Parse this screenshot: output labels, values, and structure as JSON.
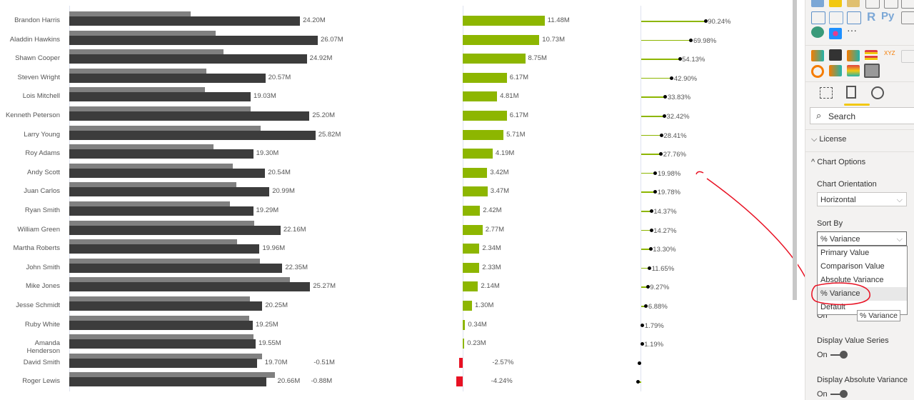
{
  "chart_data": {
    "type": "bar",
    "categories": [
      "Brandon Harris",
      "Aladdin Hawkins",
      "Shawn Cooper",
      "Steven Wright",
      "Lois Mitchell",
      "Kenneth Peterson",
      "Larry Young",
      "Roy Adams",
      "Andy Scott",
      "Juan Carlos",
      "Ryan Smith",
      "William Green",
      "Martha Roberts",
      "John Smith",
      "Mike Jones",
      "Jesse Schmidt",
      "Ruby White",
      "Amanda Henderson",
      "David Smith",
      "Roger Lewis"
    ],
    "series": [
      {
        "values": [
          24.2,
          26.07,
          24.92,
          20.57,
          19.03,
          25.2,
          25.82,
          19.3,
          20.54,
          20.99,
          19.29,
          22.16,
          19.96,
          22.35,
          25.27,
          20.25,
          19.25,
          19.55,
          19.7,
          20.66
        ],
        "labels": [
          "24.20M",
          "26.07M",
          "24.92M",
          "20.57M",
          "19.03M",
          "25.20M",
          "25.82M",
          "19.30M",
          "20.54M",
          "20.99M",
          "19.29M",
          "22.16M",
          "19.96M",
          "22.35M",
          "25.27M",
          "20.25M",
          "19.25M",
          "19.55M",
          "19.70M",
          "20.66M"
        ]
      },
      {
        "values": [
          11.48,
          10.73,
          8.75,
          6.17,
          4.81,
          6.17,
          5.71,
          4.19,
          3.42,
          3.47,
          2.42,
          2.77,
          2.34,
          2.33,
          2.14,
          1.3,
          0.34,
          0.23,
          -0.51,
          -0.88
        ],
        "labels": [
          "11.48M",
          "10.73M",
          "8.75M",
          "6.17M",
          "4.81M",
          "6.17M",
          "5.71M",
          "4.19M",
          "3.42M",
          "3.47M",
          "2.42M",
          "2.77M",
          "2.34M",
          "2.33M",
          "2.14M",
          "1.30M",
          "0.34M",
          "0.23M",
          "-0.51M",
          "-0.88M"
        ]
      },
      {
        "values": [
          90.24,
          69.98,
          54.13,
          42.9,
          33.83,
          32.42,
          28.41,
          27.76,
          19.98,
          19.78,
          14.37,
          14.27,
          13.3,
          11.65,
          9.27,
          6.88,
          1.79,
          1.19,
          -2.57,
          -4.24
        ],
        "labels": [
          "90.24%",
          "69.98%",
          "54.13%",
          "42.90%",
          "33.83%",
          "32.42%",
          "28.41%",
          "27.76%",
          "19.98%",
          "19.78%",
          "14.37%",
          "14.27%",
          "13.30%",
          "11.65%",
          "9.27%",
          "6.88%",
          "1.79%",
          "1.19%",
          "-2.57%",
          "-4.24%"
        ]
      }
    ],
    "colors": {
      "primary": "#3c3c3c",
      "comparison": "#808080",
      "positive": "#8db600",
      "negative": "#e81123",
      "marker": "#000000"
    }
  },
  "pane": {
    "search_placeholder": "Search",
    "license": "License",
    "chart_options": "Chart Options",
    "orientation_label": "Chart Orientation",
    "orientation_value": "Horizontal",
    "sort_label": "Sort By",
    "sort_value": "% Variance",
    "sort_options": [
      "Primary Value",
      "Comparison Value",
      "Absolute Variance",
      "% Variance",
      "Default"
    ],
    "tooltip": "% Variance",
    "hidden_toggle": "On",
    "value_series_label": "Display Value Series",
    "value_series_state": "On",
    "abs_variance_label": "Display Absolute Variance",
    "abs_variance_state": "On",
    "visual_icons": [
      "R",
      "Py",
      "XYZ"
    ]
  }
}
